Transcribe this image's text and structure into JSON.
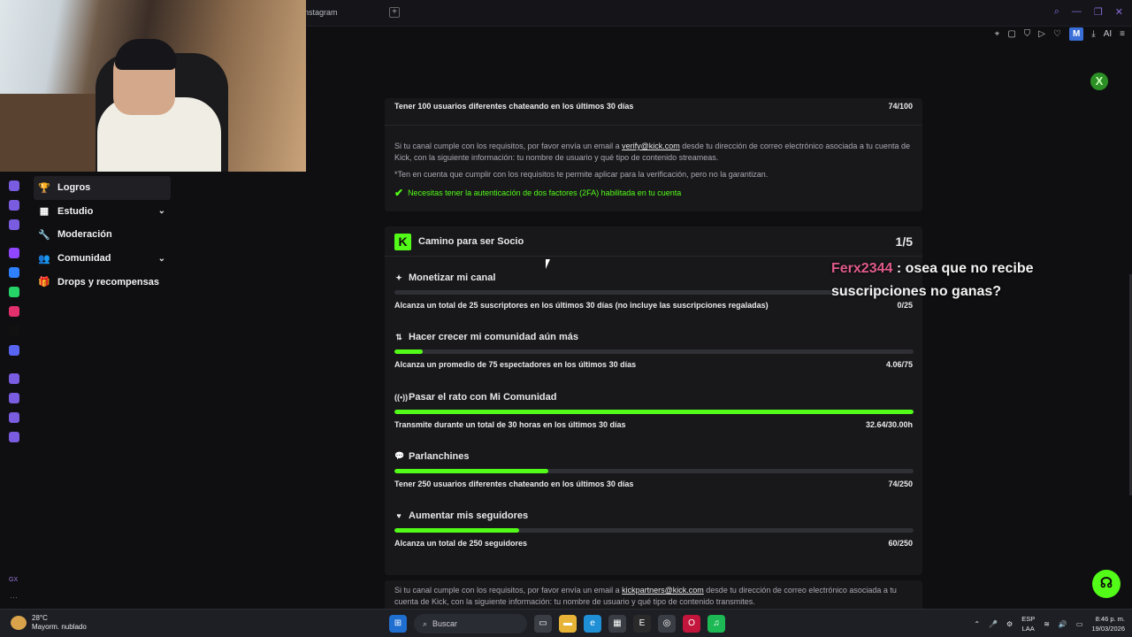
{
  "browser": {
    "tab_label": "nstagram",
    "new_tab": "+",
    "window_controls": [
      "⌕",
      "—",
      "❐",
      "✕"
    ],
    "toolbar": [
      "⌖",
      "▢",
      "⛉",
      "▷",
      "♡",
      "M",
      "⤓",
      "AI",
      "≡"
    ]
  },
  "xbox_icon": "X",
  "left_rail": {
    "icons": [
      {
        "name": "kick-icon",
        "color": "#7a5ce0"
      },
      {
        "name": "calendar-icon",
        "color": "#7a5ce0"
      },
      {
        "name": "m-icon",
        "color": "#7a5ce0"
      },
      {
        "name": "twitch-icon",
        "color": "#9146ff"
      },
      {
        "name": "messenger-icon",
        "color": "#2f80ff"
      },
      {
        "name": "whatsapp-icon",
        "color": "#25d366"
      },
      {
        "name": "instagram-icon",
        "color": "#e1306c"
      },
      {
        "name": "tiktok-icon",
        "color": "#111111"
      },
      {
        "name": "discord-icon",
        "color": "#5865f2"
      },
      {
        "name": "play-icon",
        "color": "#7a5ce0"
      },
      {
        "name": "clock-icon",
        "color": "#7a5ce0"
      },
      {
        "name": "cube-icon",
        "color": "#7a5ce0"
      },
      {
        "name": "gear-icon",
        "color": "#7a5ce0"
      }
    ],
    "gx_label": "GX",
    "more": "···"
  },
  "nav": {
    "items": [
      {
        "label": "Logros",
        "icon": "🏆",
        "active": true,
        "expandable": false
      },
      {
        "label": "Estudio",
        "icon": "▦",
        "active": false,
        "expandable": true
      },
      {
        "label": "Moderación",
        "icon": "🔧",
        "active": false,
        "expandable": false
      },
      {
        "label": "Comunidad",
        "icon": "👥",
        "active": false,
        "expandable": true
      },
      {
        "label": "Drops y recompensas",
        "icon": "🎁",
        "active": false,
        "expandable": false
      }
    ],
    "chevron": "⌄"
  },
  "verification": {
    "req_label": "Tener 100 usuarios diferentes chateando en los últimos 30 días",
    "req_value": "74/100",
    "info_pre": "Si tu canal cumple con los requisitos, por favor envía un email a ",
    "info_email": "verify@kick.com",
    "info_post": " desde tu dirección de correo electrónico asociada a tu cuenta de Kick, con la siguiente información: tu nombre de usuario y qué tipo de contenido streameas.",
    "note": "*Ten en cuenta que cumplir con los requisitos te permite aplicar para la verificación, pero no la garantizan.",
    "twofa": "Necesitas tener la autenticación de dos factores (2FA) habilitada en tu cuenta",
    "check": "✔"
  },
  "partner": {
    "logo": "K",
    "title": "Camino para ser Socio",
    "count": "1/5",
    "goals": [
      {
        "title": "Monetizar mi canal",
        "icon": "✦",
        "desc": "Alcanza un total de 25 suscriptores en los últimos 30 días (no incluye las suscripciones regaladas)",
        "value": "0/25",
        "progress": 0
      },
      {
        "title": "Hacer crecer mi comunidad aún más",
        "icon": "⇅",
        "desc": "Alcanza un promedio de 75 espectadores en los últimos 30 días",
        "value": "4.06/75",
        "progress": 0.054
      },
      {
        "title": "Pasar el rato con Mi Comunidad",
        "icon": "((•))",
        "desc": "Transmite durante un total de 30 horas en los últimos 30 días",
        "value": "32.64/30.00h",
        "progress": 1
      },
      {
        "title": "Parlanchines",
        "icon": "💬",
        "desc": "Tener 250 usuarios diferentes chateando en los últimos 30 días",
        "value": "74/250",
        "progress": 0.296
      },
      {
        "title": "Aumentar mis seguidores",
        "icon": "♥",
        "desc": "Alcanza un total de 250 seguidores",
        "value": "60/250",
        "progress": 0.24
      }
    ]
  },
  "partner_info": {
    "pre": "Si tu canal cumple con los requisitos, por favor envía un email a ",
    "email": "kickpartners@kick.com",
    "post": " desde tu dirección de correo electrónico asociada a tu cuenta de Kick, con la siguiente información: tu nombre de usuario y qué tipo de contenido transmites."
  },
  "chat_overlay": {
    "user": "Ferx2344",
    "message": " : osea que no recibe suscripciones no ganas?"
  },
  "help_icon": "☊",
  "taskbar": {
    "weather_temp": "28°C",
    "weather_desc": "Mayorm. nublado",
    "search_label": "Buscar",
    "search_icon": "⌕",
    "apps": [
      {
        "name": "file-explorer-icon",
        "glyph": "▭",
        "color": "#3a3d44"
      },
      {
        "name": "folder-icon",
        "glyph": "▬",
        "color": "#e8b437"
      },
      {
        "name": "edge-icon",
        "glyph": "e",
        "color": "#1f8fd6"
      },
      {
        "name": "store-icon",
        "glyph": "▦",
        "color": "#3a3d44"
      },
      {
        "name": "epic-icon",
        "glyph": "E",
        "color": "#2a2a2a"
      },
      {
        "name": "steam-icon",
        "glyph": "◎",
        "color": "#3a3d44"
      },
      {
        "name": "opera-gx-icon",
        "glyph": "O",
        "color": "#c4163d"
      },
      {
        "name": "spotify-icon",
        "glyph": "♫",
        "color": "#1db954"
      }
    ],
    "tray_icons": [
      "⌃",
      "🎤",
      "⚙",
      "ESP",
      "LAA"
    ],
    "lang_top": "ESP",
    "lang_bottom": "LAA",
    "time": "8:46 p. m.",
    "date": "19/03/2026"
  }
}
